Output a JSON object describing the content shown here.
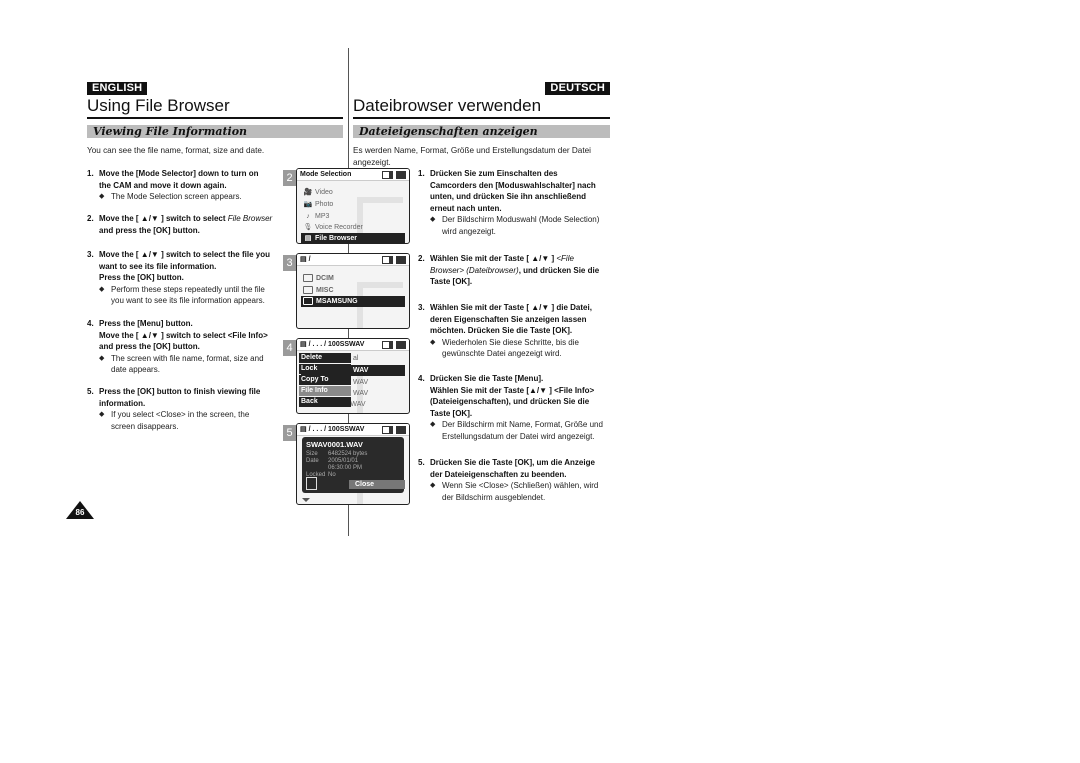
{
  "header": {
    "lang_left": "ENGLISH",
    "lang_right": "DEUTSCH",
    "title_left": "Using File Browser",
    "title_right": "Dateibrowser verwenden"
  },
  "english": {
    "section": "Viewing File Information",
    "intro": "You can see the file name, format, size and date.",
    "steps": [
      {
        "num": "1.",
        "lines": [
          "Move the [Mode Selector] down to turn on",
          "the CAM and move it down again."
        ],
        "bullet": [
          "The Mode Selection screen appears."
        ]
      },
      {
        "num": "2.",
        "lines_pre": "Move the [ ▲/▼ ] switch to select ",
        "lines_it": "File Browser",
        "line2": "and press the [OK] button."
      },
      {
        "num": "3.",
        "lines": [
          "Move the [ ▲/▼ ] switch to select the file you",
          "want to see its file information.",
          "Press the [OK] button."
        ],
        "bullet": [
          "Perform these steps repeatedly until the file",
          "you want to see its file information appears."
        ]
      },
      {
        "num": "4.",
        "lines": [
          "Press the [Menu] button.",
          "Move the [ ▲/▼ ] switch to select <File Info>",
          "and press the [OK] button."
        ],
        "bullet": [
          "The screen with file name, format, size and",
          "date appears."
        ]
      },
      {
        "num": "5.",
        "lines": [
          "Press the [OK] button to finish viewing file",
          "information."
        ],
        "bullet": [
          "If you select <Close> in the screen, the",
          "screen disappears."
        ]
      }
    ]
  },
  "deutsch": {
    "section": "Dateieigenschaften anzeigen",
    "intro": [
      "Es werden Name, Format, Größe und Erstellungsdatum der Datei",
      "angezeigt."
    ],
    "steps": [
      {
        "num": "1.",
        "lines": [
          "Drücken Sie zum Einschalten des",
          "Camcorders den [Moduswahlschalter] nach",
          "unten, und drücken Sie ihn anschließend",
          "erneut nach unten."
        ],
        "bullet": [
          "Der Bildschirm Moduswahl (Mode Selection)",
          "wird angezeigt."
        ]
      },
      {
        "num": "2.",
        "line1_pre": "Wählen Sie mit der Taste [ ▲/▼ ] ",
        "line1_it": "<File",
        "line2_it": "Browser> (Dateibrowser)",
        "line2_post": ", und drücken Sie die",
        "line3": "Taste [OK]."
      },
      {
        "num": "3.",
        "lines": [
          "Wählen Sie mit der Taste [ ▲/▼ ] die Datei,",
          "deren Eigenschaften Sie anzeigen lassen",
          "möchten. Drücken Sie die Taste [OK]."
        ],
        "bullet": [
          "Wiederholen Sie diese Schritte, bis die",
          "gewünschte Datei angezeigt wird."
        ]
      },
      {
        "num": "4.",
        "lines": [
          "Drücken Sie die Taste [Menu].",
          "Wählen Sie mit der Taste [▲/▼ ] <File Info>",
          "(Dateieigenschaften), und drücken Sie die",
          "Taste [OK]."
        ],
        "bullet": [
          "Der Bildschirm mit Name, Format, Größe und",
          "Erstellungsdatum der Datei wird angezeigt."
        ]
      },
      {
        "num": "5.",
        "lines": [
          "Drücken Sie die Taste [OK], um die Anzeige",
          "der Dateieigenschaften zu beenden."
        ],
        "bullet": [
          "Wenn Sie <Close> (Schließen) wählen, wird",
          "der Bildschirm ausgeblendet."
        ]
      }
    ]
  },
  "screens": {
    "s2": {
      "badge": "2",
      "title": "Mode Selection",
      "items": [
        {
          "icon": "video-icon",
          "glyph": "🎥",
          "label": "Video"
        },
        {
          "icon": "photo-icon",
          "glyph": "📷",
          "label": "Photo"
        },
        {
          "icon": "music-note-icon",
          "glyph": "♪",
          "label": "MP3"
        },
        {
          "icon": "microphone-icon",
          "glyph": "🎙",
          "label": "Voice Recorder"
        },
        {
          "icon": "file-icon",
          "glyph": "▤",
          "label": "File Browser",
          "selected": true
        }
      ]
    },
    "s3": {
      "badge": "3",
      "path": "/",
      "items": [
        {
          "label": "DCIM"
        },
        {
          "label": "MISC"
        },
        {
          "label": "MSAMSUNG",
          "selected": true
        }
      ]
    },
    "s4": {
      "badge": "4",
      "path": "/ . . . / 100SSWAV",
      "menu": [
        {
          "label": "Delete"
        },
        {
          "label": "Lock"
        },
        {
          "label": "Copy To"
        },
        {
          "label": "File Info",
          "selected": true
        },
        {
          "label": "Back"
        }
      ],
      "bg_rows": [
        "al",
        "WAV",
        "WAV",
        "WAV",
        "SWAV0004.WAV"
      ]
    },
    "s5": {
      "badge": "5",
      "path": "/ . . . / 100SSWAV",
      "filename": "SWAV0001.WAV",
      "size_label": "Size",
      "size_value": "6482524 bytes",
      "date_label": "Date",
      "date_value": "2005/01/01",
      "time_value": "06:30:00 PM",
      "locked_label": "Locked",
      "locked_value": "No",
      "close_label": "Close"
    }
  },
  "page_number": "86"
}
